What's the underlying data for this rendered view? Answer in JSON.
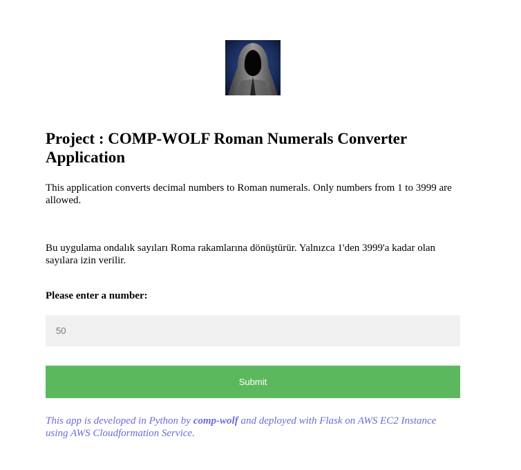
{
  "logo": {
    "icon": "hooded-figure-logo",
    "alt": "hooded figure"
  },
  "heading": {
    "title": "Project : COMP-WOLF Roman Numerals Converter Application"
  },
  "descriptions": {
    "english": "This application converts decimal numbers to Roman numerals. Only numbers from 1 to 3999 are allowed.",
    "turkish": "Bu uygulama ondalık sayıları Roma rakamlarına dönüştürür. Yalnızca 1'den 3999'a kadar olan sayılara izin verilir."
  },
  "form": {
    "label": "Please enter a number:",
    "input_value": "",
    "input_placeholder": "50",
    "submit_label": "Submit",
    "submit_color": "#5cb85c"
  },
  "footer": {
    "prefix": "This app is developed in Python by ",
    "author": "comp-wolf",
    "suffix": " and deployed with Flask on AWS EC2 Instance using AWS Cloudformation Service.",
    "color": "#6a6adb"
  }
}
